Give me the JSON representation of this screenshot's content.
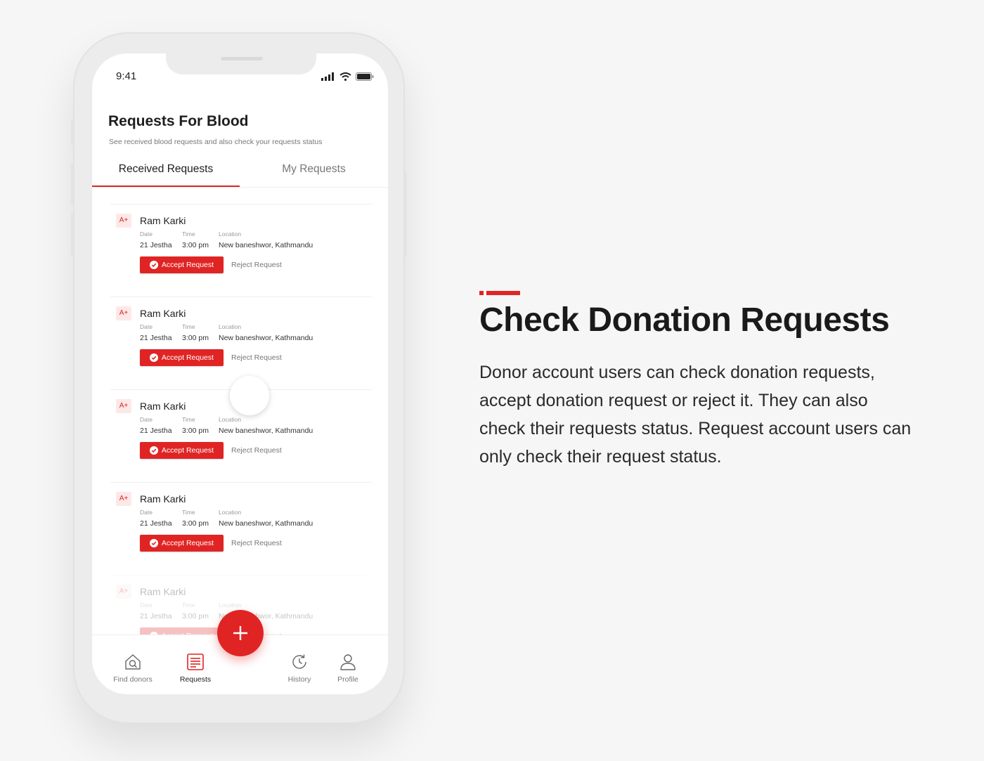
{
  "status_bar": {
    "time": "9:41"
  },
  "header": {
    "title": "Requests For Blood",
    "subtitle": "See received blood requests and also check your requests status"
  },
  "tabs": [
    {
      "label": "Received Requests",
      "active": true
    },
    {
      "label": "My Requests",
      "active": false
    }
  ],
  "requests": [
    {
      "blood_group": "A+",
      "name": "Ram Karki",
      "date_label": "Date",
      "date": "21 Jestha",
      "time_label": "Time",
      "time": "3:00 pm",
      "location_label": "Location",
      "location": "New baneshwor, Kathmandu",
      "accept_label": "Accept Request",
      "reject_label": "Reject Request"
    },
    {
      "blood_group": "A+",
      "name": "Ram Karki",
      "date_label": "Date",
      "date": "21 Jestha",
      "time_label": "Time",
      "time": "3:00 pm",
      "location_label": "Location",
      "location": "New baneshwor, Kathmandu",
      "accept_label": "Accept Request",
      "reject_label": "Reject Request"
    },
    {
      "blood_group": "A+",
      "name": "Ram Karki",
      "date_label": "Date",
      "date": "21 Jestha",
      "time_label": "Time",
      "time": "3:00 pm",
      "location_label": "Location",
      "location": "New baneshwor, Kathmandu",
      "accept_label": "Accept Request",
      "reject_label": "Reject Request"
    },
    {
      "blood_group": "A+",
      "name": "Ram Karki",
      "date_label": "Date",
      "date": "21 Jestha",
      "time_label": "Time",
      "time": "3:00 pm",
      "location_label": "Location",
      "location": "New baneshwor, Kathmandu",
      "accept_label": "Accept Request",
      "reject_label": "Reject Request"
    },
    {
      "blood_group": "A+",
      "name": "Ram Karki",
      "date_label": "Date",
      "date": "21 Jestha",
      "time_label": "Time",
      "time": "3:00 pm",
      "location_label": "Location",
      "location": "New baneshwor, Kathmandu",
      "accept_label": "Accept Request",
      "reject_label": "Reject Request"
    }
  ],
  "bottom_nav": [
    {
      "label": "Find donors",
      "icon": "home-search-icon",
      "active": false
    },
    {
      "label": "Requests",
      "icon": "document-list-icon",
      "active": true
    },
    {
      "label": "History",
      "icon": "clock-history-icon",
      "active": false
    },
    {
      "label": "Profile",
      "icon": "user-icon",
      "active": false
    }
  ],
  "fab": {
    "icon": "plus-icon"
  },
  "promo": {
    "headline": "Check Donation Requests",
    "description": "Donor account users can check donation requests, accept donation request or reject it. They can also check their requests status. Request account users can only check their request status."
  },
  "colors": {
    "accent": "#e02424",
    "badge_bg": "#fde8e8",
    "background": "#f6f6f6"
  }
}
